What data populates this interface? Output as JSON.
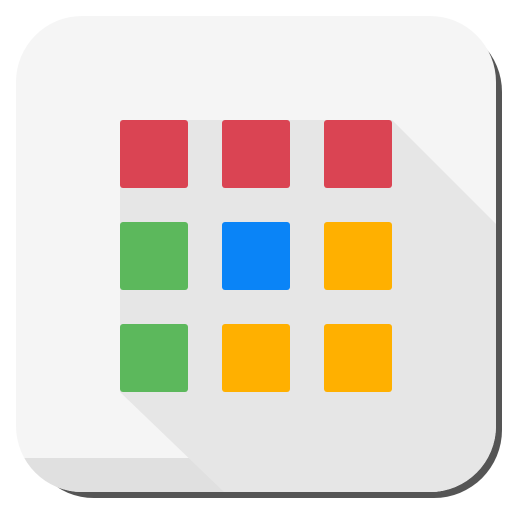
{
  "icon": {
    "name": "apps-grid",
    "colors": {
      "tile": "#f5f5f5",
      "tile_bottom": "#e0e0e0",
      "outer_shadow": "#555555",
      "long_shadow": "#e6e6e6"
    },
    "grid": [
      [
        "#da4453",
        "#da4453",
        "#da4453"
      ],
      [
        "#5cb85c",
        "#0a84f7",
        "#ffb000"
      ],
      [
        "#5cb85c",
        "#ffb000",
        "#ffb000"
      ]
    ]
  }
}
